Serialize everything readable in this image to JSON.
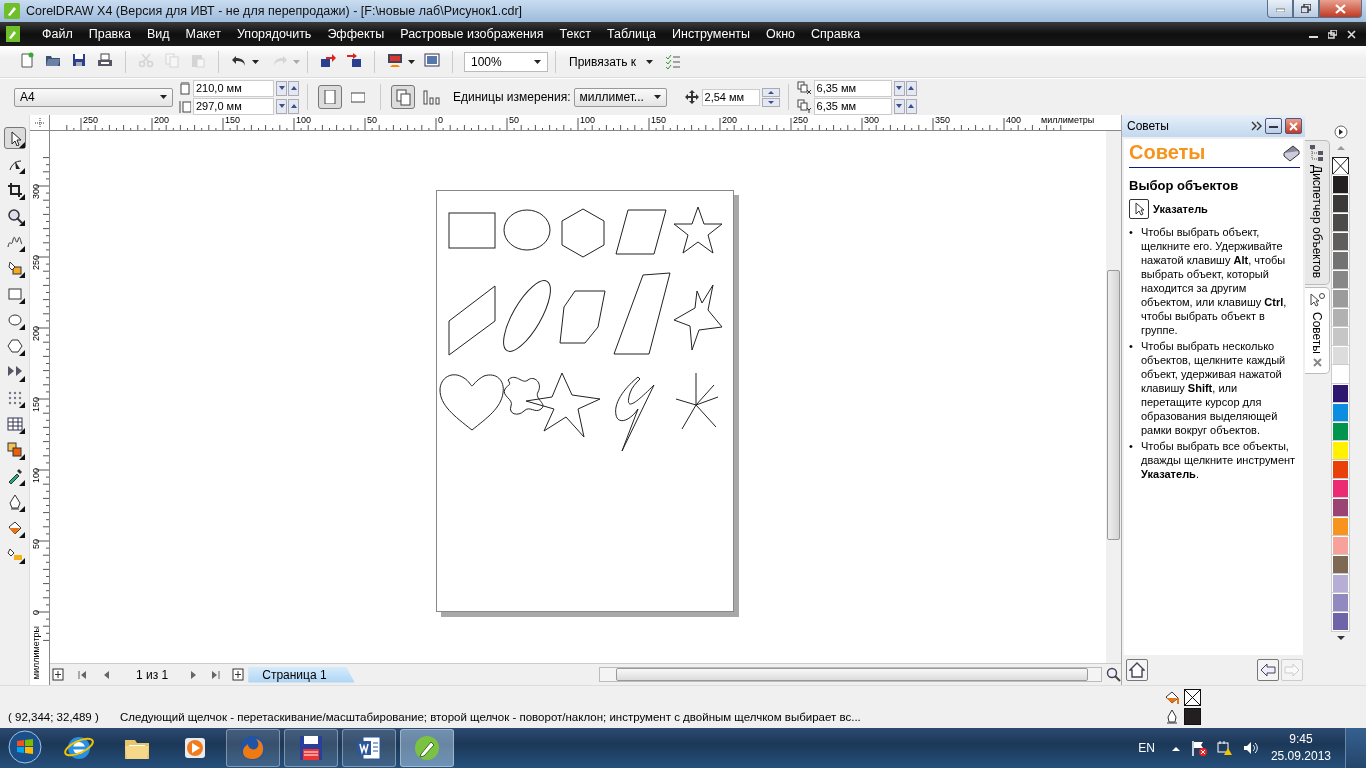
{
  "window": {
    "title": "CorelDRAW X4 (Версия для ИВТ - не для перепродажи) - [F:\\новые лаб\\Рисунок1.cdr]"
  },
  "menu": [
    "Файл",
    "Правка",
    "Вид",
    "Макет",
    "Упорядочить",
    "Эффекты",
    "Растровые изображения",
    "Текст",
    "Таблица",
    "Инструменты",
    "Окно",
    "Справка"
  ],
  "toolbar": {
    "buttons": [
      {
        "disabled": false
      },
      {
        "disabled": false
      },
      {
        "disabled": false
      },
      {
        "disabled": false
      },
      {
        "disabled": true
      },
      {
        "disabled": true
      },
      {
        "disabled": true
      },
      {
        "disabled": false
      },
      {
        "disabled": true
      },
      {
        "disabled": false
      },
      {
        "disabled": false
      },
      {
        "disabled": false
      },
      {
        "disabled": false
      }
    ],
    "zoom": "100%",
    "snap": "Привязать к"
  },
  "property_bar": {
    "page_size": "A4",
    "width": "210,0 мм",
    "height": "297,0 мм",
    "orientation": [
      {
        "selected": true
      },
      {
        "selected": false
      }
    ],
    "page_scope": [
      {
        "selected": true
      },
      {
        "selected": false
      }
    ],
    "units_label": "Единицы измерения:",
    "units": "миллимет...",
    "nudge": "2,54 мм",
    "duplicate_x": "6,35 мм",
    "duplicate_y": "6,35 мм"
  },
  "tools": [
    {
      "selected": true
    },
    {
      "selected": false
    },
    {
      "selected": false
    },
    {
      "selected": false
    },
    {
      "selected": false
    },
    {
      "selected": false
    },
    {
      "selected": false
    },
    {
      "selected": false
    },
    {
      "selected": false
    },
    {
      "selected": false
    },
    {
      "selected": false
    },
    {
      "selected": false
    },
    {
      "selected": false
    },
    {
      "selected": false
    },
    {
      "selected": false
    },
    {
      "selected": false
    },
    {
      "selected": false
    }
  ],
  "canvas": {
    "horizontal_ruler": {
      "labels": [
        "250",
        "200",
        "150",
        "100",
        "50",
        "0",
        "50",
        "100",
        "150",
        "200",
        "250",
        "300",
        "350",
        "400"
      ],
      "unit": "миллиметры"
    },
    "vertical_ruler": {
      "labels": [
        "300",
        "250",
        "200",
        "150",
        "100",
        "50",
        "0"
      ],
      "unit": "миллиметры"
    }
  },
  "page_nav": {
    "counter": "1 из 1",
    "tabs": [
      {
        "label": "Страница 1",
        "selected": true
      }
    ]
  },
  "docker": {
    "title": "Советы",
    "heading": "Советы",
    "section": "Выбор объектов",
    "tool": "Указатель",
    "bullets": [
      {
        "marker": "•",
        "text": "Чтобы выбрать объект, щелкните его. Удерживайте нажатой клавишу **Alt**, чтобы выбрать объект, который находится за другим объектом, или клавишу **Ctrl**, чтобы выбрать объект в группе."
      },
      {
        "marker": "•",
        "text": "Чтобы выбрать несколько объектов, щелкните каждый объект, удерживая нажатой клавишу **Shift**, или перетащите курсор для образования выделяющей рамки вокруг объектов."
      },
      {
        "marker": "•",
        "text": "Чтобы выбрать все объекты, дважды щелкните инструмент **Указатель**."
      }
    ],
    "nav": [
      {
        "disabled": false
      },
      {
        "disabled": false
      },
      {
        "disabled": true
      }
    ]
  },
  "side_tabs": [
    {
      "label": "Диспетчер объектов",
      "selected": false
    },
    {
      "label": "Советы",
      "selected": true
    }
  ],
  "palette": [
    {
      "color": "#231f20"
    },
    {
      "color": "#3c3a39"
    },
    {
      "color": "#4d4b4a"
    },
    {
      "color": "#5f5e5d"
    },
    {
      "color": "#737272"
    },
    {
      "color": "#878787"
    },
    {
      "color": "#9c9b9b"
    },
    {
      "color": "#b1b1b1"
    },
    {
      "color": "#c6c6c6"
    },
    {
      "color": "#dcdcdc"
    },
    {
      "color": "#ffffff"
    },
    {
      "color": "#2e1670"
    },
    {
      "color": "#0b8ee0"
    },
    {
      "color": "#00944c"
    },
    {
      "color": "#fff100"
    },
    {
      "color": "#e8420a"
    },
    {
      "color": "#ec2b72"
    },
    {
      "color": "#9b4372"
    },
    {
      "color": "#f7941d"
    },
    {
      "color": "#f6a29b"
    },
    {
      "color": "#7e6a52"
    },
    {
      "color": "#b7aed5"
    },
    {
      "color": "#918ac0"
    },
    {
      "color": "#6e64a8"
    }
  ],
  "status_bar": {
    "coordinates": "( 92,344; 32,489 )",
    "message": "Следующий щелчок - перетаскивание/масштабирование; второй щелчок - поворот/наклон; инструмент с двойным щелчком выбирает вс..."
  },
  "taskbar": {
    "apps": [
      {
        "running": false,
        "selected": false
      },
      {
        "running": false,
        "selected": false
      },
      {
        "running": false,
        "selected": false
      },
      {
        "running": true,
        "selected": false
      },
      {
        "running": true,
        "selected": false
      },
      {
        "running": true,
        "selected": false
      },
      {
        "running": true,
        "selected": true
      }
    ],
    "language": "EN",
    "time": "9:45",
    "date": "25.09.2013"
  }
}
